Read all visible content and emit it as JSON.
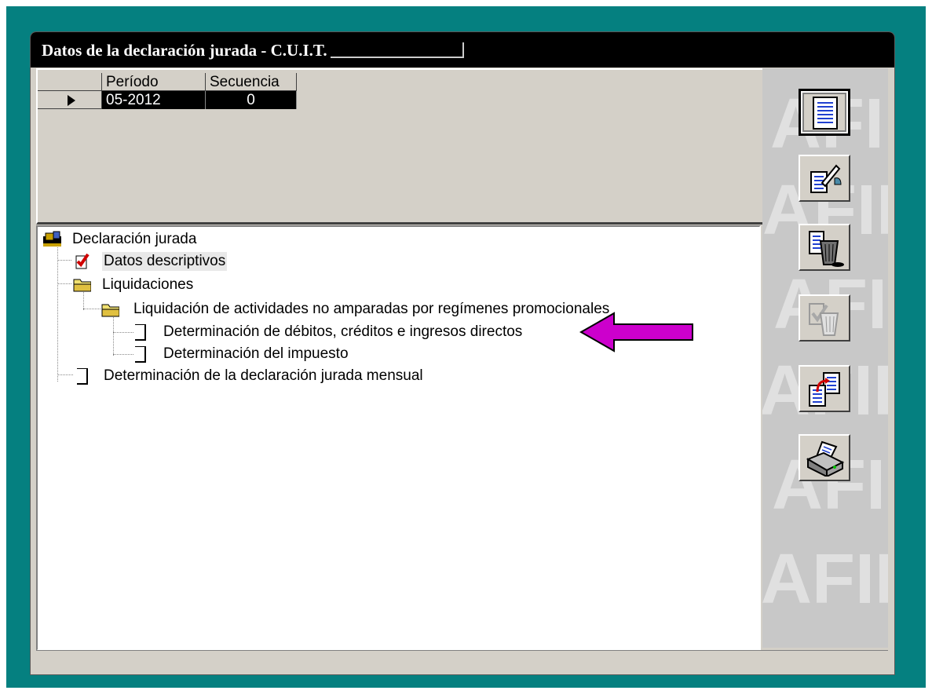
{
  "window": {
    "title": "Datos de la declaración jurada - C.U.I.T."
  },
  "grid": {
    "columns": [
      "Período",
      "Secuencia"
    ],
    "rows": [
      {
        "periodo": "05-2012",
        "secuencia": "0"
      }
    ]
  },
  "tree": {
    "root": "Declaración jurada",
    "items": [
      "Datos descriptivos",
      "Liquidaciones",
      "Liquidación de actividades no amparadas por regímenes promocionales",
      "Determinación de débitos, créditos e ingresos directos",
      "Determinación del impuesto",
      "Determinación de la declaración jurada mensual"
    ]
  },
  "toolbar": {
    "buttons": [
      {
        "icon": "form-list-icon",
        "state": "active"
      },
      {
        "icon": "edit-document-icon",
        "state": "enabled"
      },
      {
        "icon": "delete-document-icon",
        "state": "enabled"
      },
      {
        "icon": "delete-disabled-icon",
        "state": "disabled"
      },
      {
        "icon": "copy-document-icon",
        "state": "enabled"
      },
      {
        "icon": "print-icon",
        "state": "enabled"
      }
    ]
  },
  "colors": {
    "desktop": "#058080",
    "arrow": "#cc00cc"
  }
}
